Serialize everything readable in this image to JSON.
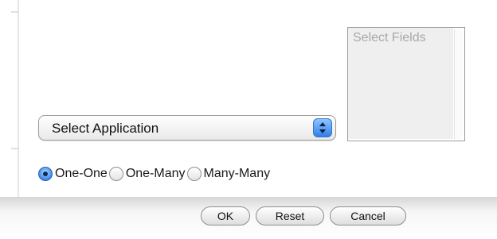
{
  "fields_list": {
    "header": "Select Fields"
  },
  "application_select": {
    "selected": "Select Application",
    "icon": "up-down-arrows-icon"
  },
  "relationship_options": [
    {
      "label": "One-One",
      "checked": true
    },
    {
      "label": "One-Many",
      "checked": false
    },
    {
      "label": "Many-Many",
      "checked": false
    }
  ],
  "buttons": {
    "ok": "OK",
    "reset": "Reset",
    "cancel": "Cancel"
  },
  "colors": {
    "accent": "#3d86e6"
  }
}
